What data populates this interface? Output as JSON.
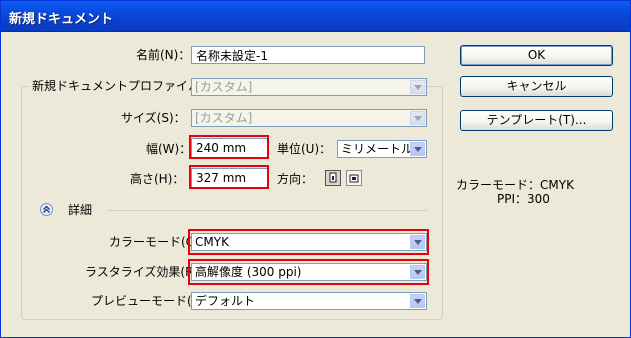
{
  "window": {
    "title": "新規ドキュメント"
  },
  "fields": {
    "name_label": "名前(N)：",
    "name_value": "名称未設定-1",
    "profile_label": "新規ドキュメントプロファイル(P)：",
    "profile_value": "[カスタム]",
    "size_label": "サイズ(S)：",
    "size_value": "[カスタム]",
    "width_label": "幅(W)：",
    "width_value": "240 mm",
    "unit_label": "単位(U)：",
    "unit_value": "ミリメートル",
    "height_label": "高さ(H)：",
    "height_value": "327 mm",
    "orientation_label": "方向：",
    "advanced_label": "詳細",
    "color_mode_label": "カラーモード(C)：",
    "color_mode_value": "CMYK",
    "raster_label": "ラスタライズ効果(R)：",
    "raster_value": "高解像度 (300 ppi)",
    "preview_label": "プレビューモード(E)：",
    "preview_value": "デフォルト"
  },
  "buttons": {
    "ok": "OK",
    "cancel": "キャンセル",
    "template": "テンプレート(T)..."
  },
  "info": {
    "color_mode": "カラーモード：CMYK",
    "ppi": "PPI：300"
  },
  "colors": {
    "highlight": "#e8000b",
    "titlebar": "#0a46d7"
  }
}
